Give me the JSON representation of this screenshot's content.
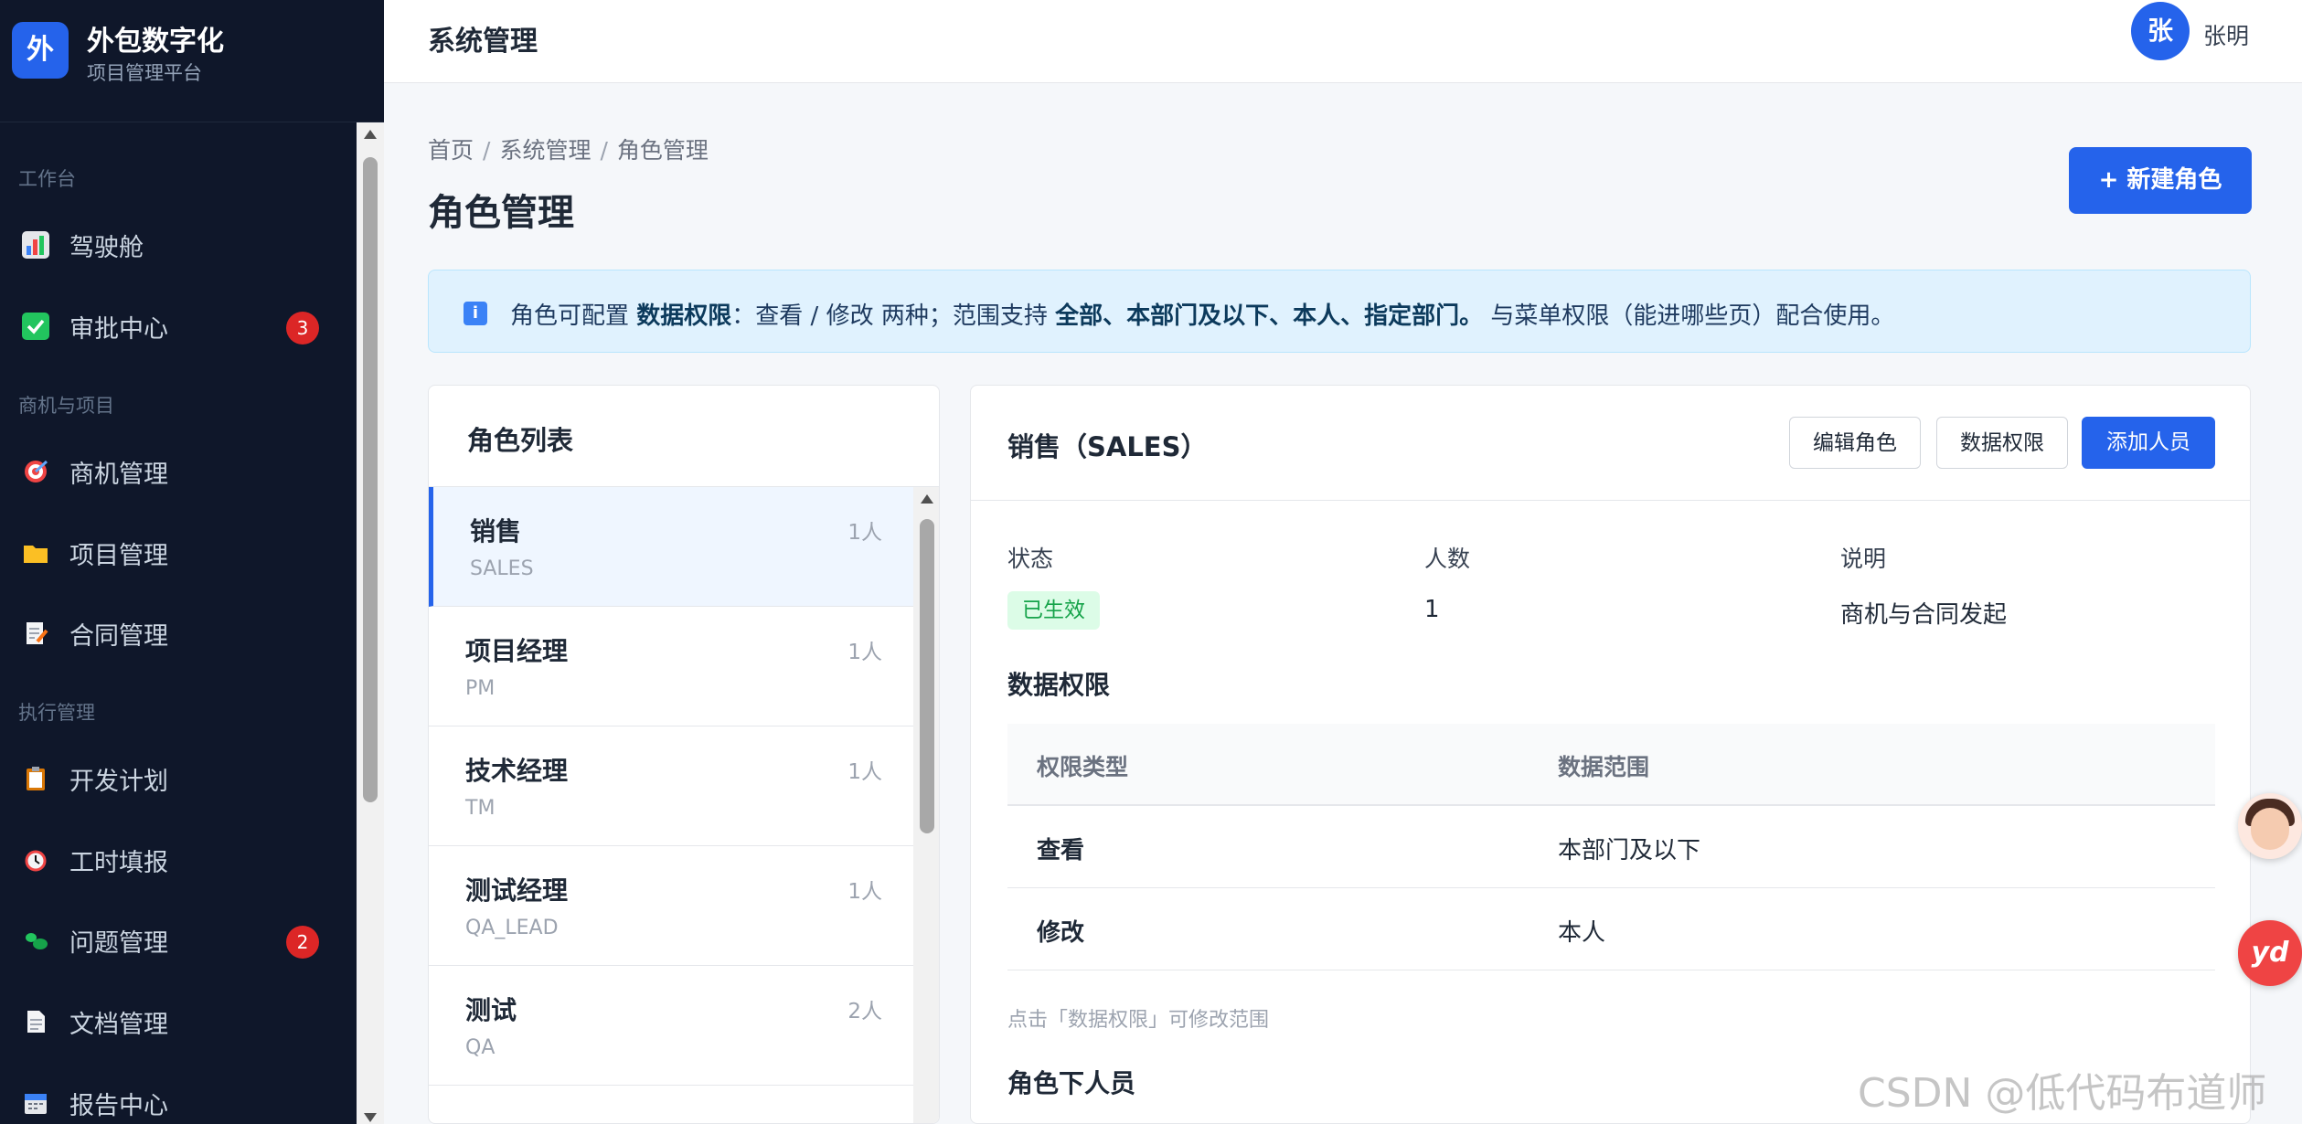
{
  "brand": {
    "logo_char": "外",
    "title": "外包数字化",
    "subtitle": "项目管理平台"
  },
  "sidebar": {
    "groups": [
      {
        "label": "工作台"
      },
      {
        "label": "商机与项目"
      },
      {
        "label": "执行管理"
      }
    ],
    "items": [
      {
        "label": "驾驶舱",
        "icon": "bar-chart-icon"
      },
      {
        "label": "审批中心",
        "icon": "checkbox-icon",
        "badge": "3"
      },
      {
        "label": "商机管理",
        "icon": "target-icon"
      },
      {
        "label": "项目管理",
        "icon": "folder-icon"
      },
      {
        "label": "合同管理",
        "icon": "document-edit-icon"
      },
      {
        "label": "开发计划",
        "icon": "clipboard-icon"
      },
      {
        "label": "工时填报",
        "icon": "alarm-clock-icon"
      },
      {
        "label": "问题管理",
        "icon": "bug-icon",
        "badge": "2"
      },
      {
        "label": "文档管理",
        "icon": "page-icon"
      },
      {
        "label": "报告中心",
        "icon": "calendar-icon"
      }
    ]
  },
  "header": {
    "title": "系统管理",
    "user": {
      "avatar_char": "张",
      "name": "张明"
    }
  },
  "breadcrumb": [
    "首页",
    "系统管理",
    "角色管理"
  ],
  "breadcrumb_separator": "/",
  "page": {
    "title": "角色管理",
    "new_button": "+ 新建角色"
  },
  "banner": {
    "t1": "角色可配置 ",
    "b1": "数据权限",
    "t2": "：查看 / 修改 两种；范围支持 ",
    "b2": "全部、本部门及以下、本人、指定部门。",
    "t3": " 与菜单权限（能进哪些页）配合使用。"
  },
  "role_list": {
    "title": "角色列表",
    "items": [
      {
        "name": "销售",
        "code": "SALES",
        "count": "1人",
        "active": true
      },
      {
        "name": "项目经理",
        "code": "PM",
        "count": "1人"
      },
      {
        "name": "技术经理",
        "code": "TM",
        "count": "1人"
      },
      {
        "name": "测试经理",
        "code": "QA_LEAD",
        "count": "1人"
      },
      {
        "name": "测试",
        "code": "QA",
        "count": "2人"
      }
    ]
  },
  "detail": {
    "title": "销售（SALES）",
    "buttons": {
      "edit": "编辑角色",
      "data_perm": "数据权限",
      "add_member": "添加人员"
    },
    "fields": {
      "status_label": "状态",
      "status_value": "已生效",
      "count_label": "人数",
      "count_value": "1",
      "desc_label": "说明",
      "desc_value": "商机与合同发起"
    },
    "perm_section_title": "数据权限",
    "perm_table": {
      "headers": [
        "权限类型",
        "数据范围"
      ],
      "rows": [
        {
          "type": "查看",
          "scope": "本部门及以下"
        },
        {
          "type": "修改",
          "scope": "本人"
        }
      ]
    },
    "hint": "点击「数据权限」可修改范围",
    "members_title": "角色下人员"
  },
  "floating": {
    "yd_label": "yd"
  },
  "watermark": "CSDN @低代码布道师",
  "colors": {
    "sidebar_bg": "#0f172a",
    "accent": "#2563eb",
    "badge_red": "#dc2626",
    "success_bg": "#dcfce7",
    "success_text": "#16a34a",
    "banner_bg": "#e0f2fe"
  }
}
